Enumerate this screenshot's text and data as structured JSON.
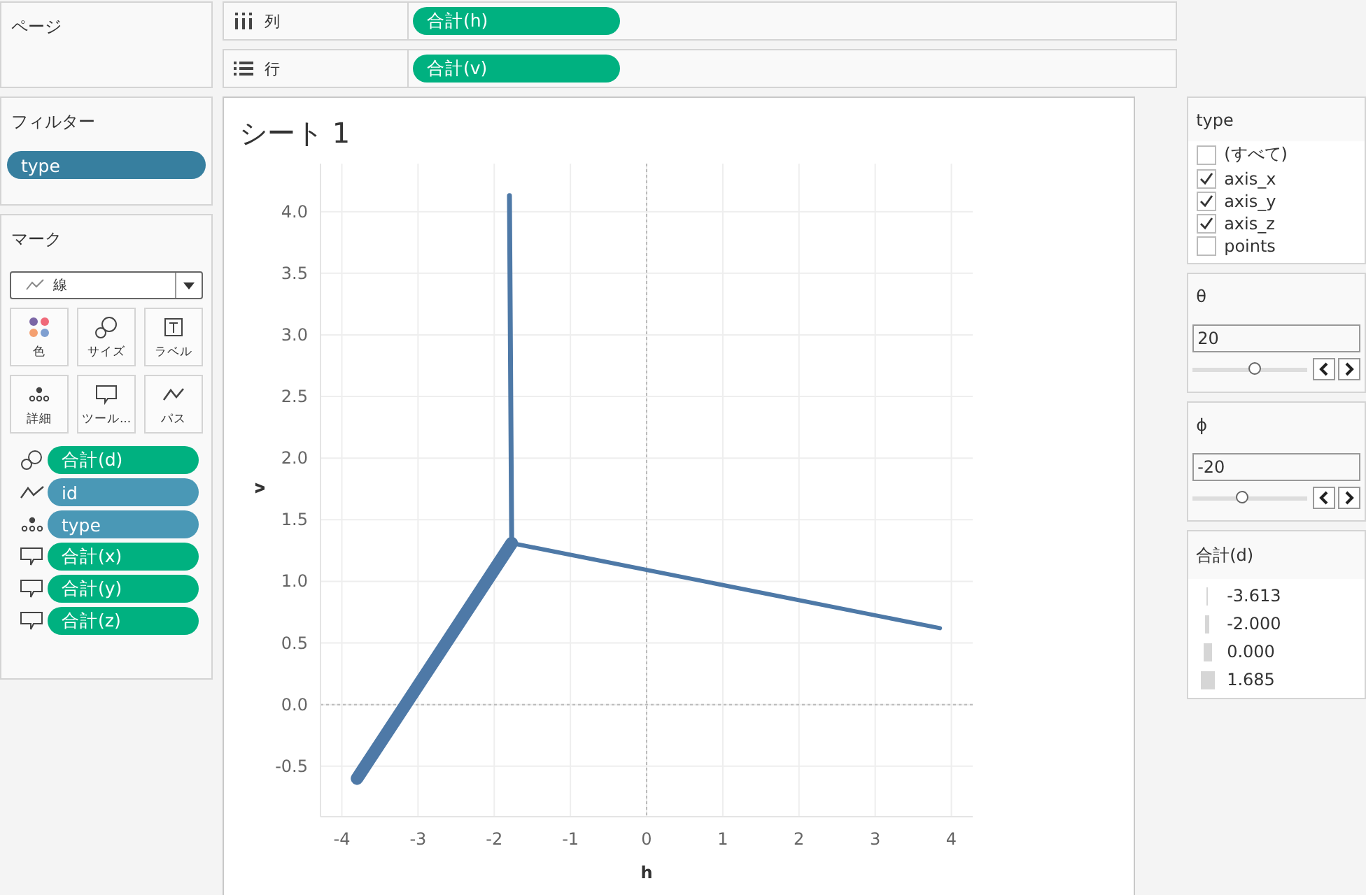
{
  "pages_card": {
    "title": "ページ"
  },
  "filters_card": {
    "title": "フィルター",
    "pills": [
      {
        "label": "type",
        "color": "#377f9f"
      }
    ]
  },
  "marks_card": {
    "title": "マーク",
    "mark_type": "線",
    "buttons": [
      {
        "label": "色",
        "kind": "color"
      },
      {
        "label": "サイズ",
        "kind": "size"
      },
      {
        "label": "ラベル",
        "kind": "label"
      },
      {
        "label": "詳細",
        "kind": "detail"
      },
      {
        "label": "ツール...",
        "kind": "tooltip"
      },
      {
        "label": "パス",
        "kind": "path"
      }
    ],
    "fields": [
      {
        "kind": "size",
        "color": "#00b180",
        "label": "合計(d)"
      },
      {
        "kind": "path",
        "color": "#4a98b6",
        "label": "id"
      },
      {
        "kind": "detail",
        "color": "#4a98b6",
        "label": "type"
      },
      {
        "kind": "tooltip",
        "color": "#00b180",
        "label": "合計(x)"
      },
      {
        "kind": "tooltip",
        "color": "#00b180",
        "label": "合計(y)"
      },
      {
        "kind": "tooltip",
        "color": "#00b180",
        "label": "合計(z)"
      }
    ]
  },
  "shelves": [
    {
      "kind": "columns",
      "label": "列",
      "pill": "合計(h)"
    },
    {
      "kind": "rows",
      "label": "行",
      "pill": "合計(v)"
    }
  ],
  "sheet": {
    "title": "シート 1",
    "chart_data": {
      "type": "line",
      "xlabel": "h",
      "ylabel": "v",
      "xlim": [
        -4.28,
        4.28
      ],
      "ylim": [
        -0.91,
        4.39
      ],
      "grid": true,
      "xticks": [
        -4,
        -3,
        -2,
        -1,
        0,
        1,
        2,
        3,
        4
      ],
      "yticks": [
        -0.5,
        {
          "value": 0,
          "label": "0.0"
        },
        0.5,
        {
          "value": 1,
          "label": "1.0"
        },
        1.5,
        {
          "value": 2,
          "label": "2.0"
        },
        2.5,
        {
          "value": 3,
          "label": "3.0"
        },
        3.5,
        {
          "value": 4,
          "label": "4.0"
        }
      ],
      "series": [
        {
          "color": "#4e79a7",
          "x": [
            -1.77,
            3.85
          ],
          "values": [
            1.31,
            0.62
          ]
        },
        {
          "color": "#4e79a7",
          "x": [
            -1.77,
            -3.8
          ],
          "values": [
            1.31,
            -0.6
          ]
        },
        {
          "color": "#4e79a7",
          "x": [
            -1.77,
            -1.8
          ],
          "values": [
            1.31,
            4.13
          ]
        }
      ]
    }
  },
  "type_filter": {
    "title": "type",
    "items": [
      {
        "label": "(すべて)",
        "checked": false
      },
      {
        "label": "axis_x",
        "checked": true
      },
      {
        "label": "axis_y",
        "checked": true
      },
      {
        "label": "axis_z",
        "checked": true
      },
      {
        "label": "points",
        "checked": false
      }
    ]
  },
  "parameters": [
    {
      "title": "θ",
      "value": "20",
      "level": 0.55
    },
    {
      "title": "ϕ",
      "value": "-20",
      "level": 0.44
    }
  ],
  "size_legend": {
    "title": "合計(d)",
    "items": [
      {
        "label": "-3.613"
      },
      {
        "label": "-2.000"
      },
      {
        "label": "0.000"
      },
      {
        "label": "1.685"
      }
    ]
  }
}
